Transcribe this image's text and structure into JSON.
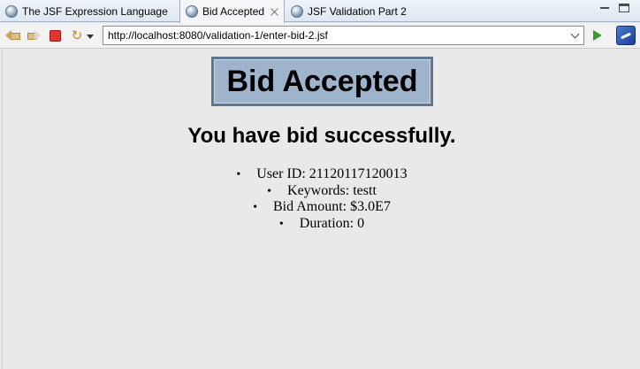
{
  "tabs": [
    {
      "label": "The JSF Expression Language",
      "active": false
    },
    {
      "label": "Bid Accepted",
      "active": true
    },
    {
      "label": "JSF Validation Part 2",
      "active": false
    }
  ],
  "toolbar": {
    "url": "http://localhost:8080/validation-1/enter-bid-2.jsf",
    "icons": [
      "back-arrow-icon",
      "forward-arrow-icon",
      "stop-icon",
      "refresh-icon",
      "dropdown-icon",
      "go-icon",
      "browser-icon"
    ]
  },
  "page": {
    "banner": "Bid Accepted",
    "subtitle": "You have bid successfully.",
    "details": [
      "User ID: 21120117120013",
      "Keywords: testt",
      "Bid Amount: $3.0E7",
      "Duration: 0"
    ]
  },
  "colors": {
    "banner_bg": "#9eb4cc",
    "banner_border": "#5c7891",
    "page_bg": "#e9e9e9"
  }
}
